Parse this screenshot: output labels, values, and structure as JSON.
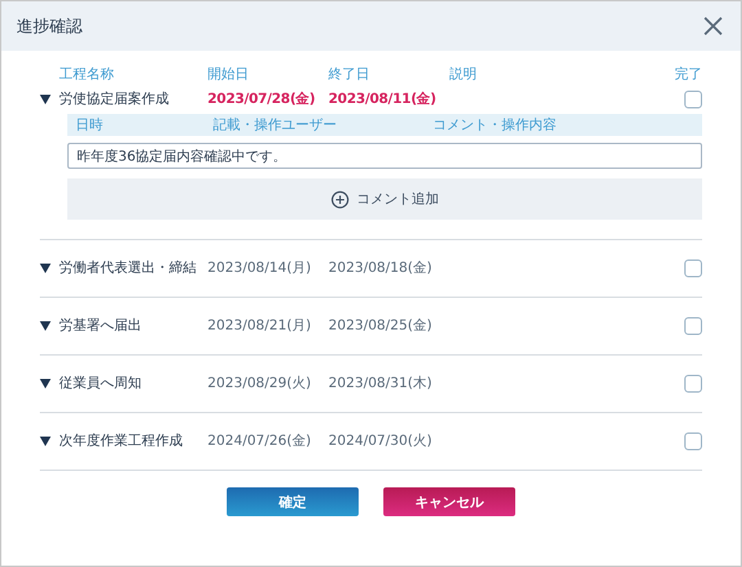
{
  "dialog": {
    "title": "進捗確認"
  },
  "columns": [
    "工程名称",
    "開始日",
    "終了日",
    "説明",
    "完了"
  ],
  "steps": [
    {
      "name": "労使協定届案作成",
      "start": "2023/07/28(金)",
      "end": "2023/08/11(金)",
      "overdue": true,
      "checked": false,
      "comments": {
        "columns": [
          "日時",
          "記載・操作ユーザー",
          "コメント・操作内容"
        ],
        "input": "昨年度36協定届内容確認中です。",
        "add_label": "コメント追加"
      }
    },
    {
      "name": "労働者代表選出・締結",
      "start": "2023/08/14(月)",
      "end": "2023/08/18(金)",
      "overdue": false,
      "checked": false
    },
    {
      "name": "労基署へ届出",
      "start": "2023/08/21(月)",
      "end": "2023/08/25(金)",
      "overdue": false,
      "checked": false
    },
    {
      "name": "従業員へ周知",
      "start": "2023/08/29(火)",
      "end": "2023/08/31(木)",
      "overdue": false,
      "checked": false
    },
    {
      "name": "次年度作業工程作成",
      "start": "2024/07/26(金)",
      "end": "2024/07/30(火)",
      "overdue": false,
      "checked": false
    }
  ],
  "buttons": [
    {
      "label": "確定",
      "kind": "primary"
    },
    {
      "label": "キャンセル",
      "kind": "danger"
    }
  ]
}
